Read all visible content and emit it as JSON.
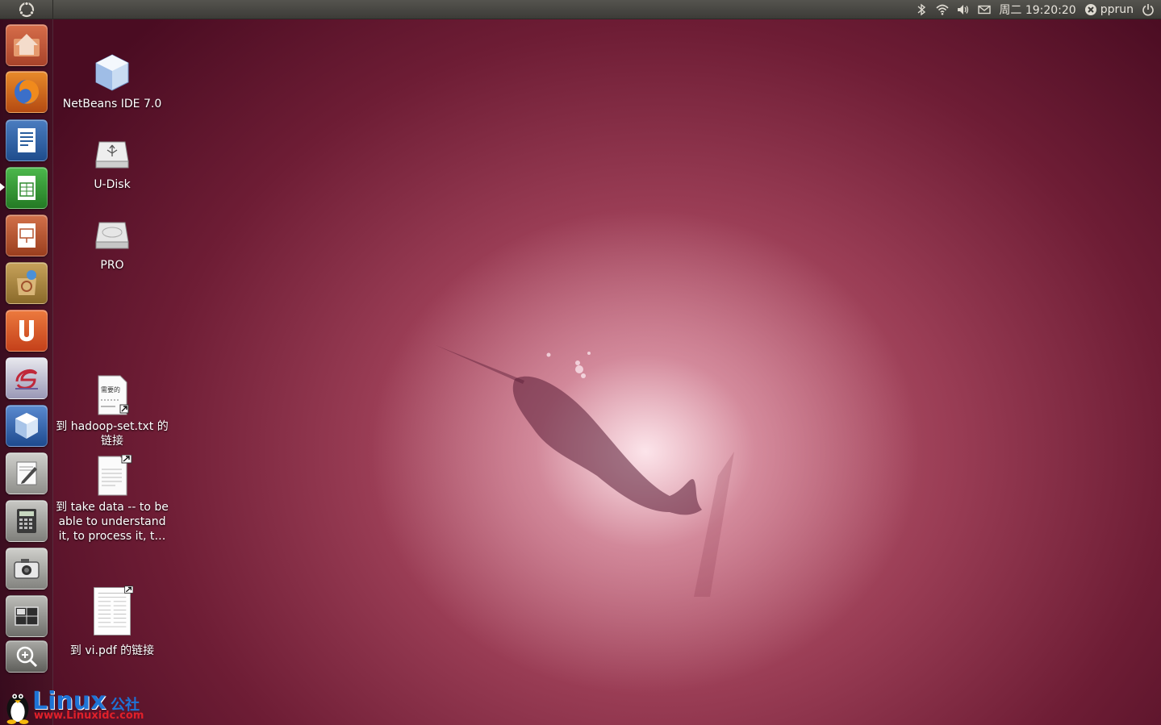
{
  "top_panel": {
    "clock": "周二 19:20:20",
    "user": "pprun",
    "indicators": [
      "bluetooth-icon",
      "wifi-icon",
      "volume-icon",
      "mail-icon",
      "session-icon",
      "power-icon"
    ]
  },
  "launcher": {
    "items": [
      {
        "name": "home-folder",
        "icon": "home-folder-icon",
        "color": "#c25a3a"
      },
      {
        "name": "firefox",
        "icon": "firefox-icon",
        "color": "#e66a1f"
      },
      {
        "name": "libreoffice-writer",
        "icon": "writer-icon",
        "color": "#2a5e9e"
      },
      {
        "name": "libreoffice-calc",
        "icon": "calc-icon",
        "color": "#3a9a3a"
      },
      {
        "name": "libreoffice-impress",
        "icon": "impress-icon",
        "color": "#b5542e"
      },
      {
        "name": "software-center",
        "icon": "software-center-icon",
        "color": "#b28a3c"
      },
      {
        "name": "ubuntu-one",
        "icon": "ubuntu-one-icon",
        "color": "#dd5a24"
      },
      {
        "name": "eclipse",
        "icon": "eclipse-icon",
        "color": "#b6303d"
      },
      {
        "name": "netbeans",
        "icon": "netbeans-icon",
        "color": "#2f5fa5"
      },
      {
        "name": "text-editor",
        "icon": "text-editor-icon",
        "color": "#9a9a96"
      },
      {
        "name": "calculator",
        "icon": "calculator-icon",
        "color": "#8a8a88"
      },
      {
        "name": "screenshot",
        "icon": "camera-icon",
        "color": "#8e8e8c"
      },
      {
        "name": "workspace-switcher",
        "icon": "workspace-icon",
        "color": "#7a7a78"
      },
      {
        "name": "dash-search",
        "icon": "magnifier-icon",
        "color": "#6a6a68"
      }
    ]
  },
  "desktop": {
    "icons": [
      {
        "label": "NetBeans IDE 7.0",
        "icon": "netbeans-cube-icon"
      },
      {
        "label": "U-Disk",
        "icon": "usb-drive-icon"
      },
      {
        "label": "PRO",
        "icon": "hard-drive-icon"
      },
      {
        "label": "到 hadoop-set.txt 的链接",
        "icon": "text-file-link-icon",
        "thumb_text": "需要的"
      },
      {
        "label": "到 take data -- to be able to understand it, to process it, t…",
        "icon": "document-link-icon"
      },
      {
        "label": "到 vi.pdf 的链接",
        "icon": "pdf-link-icon"
      }
    ]
  },
  "watermark": {
    "text": "Linux",
    "cn": "公社",
    "url": "www.Linuxidc.com"
  }
}
